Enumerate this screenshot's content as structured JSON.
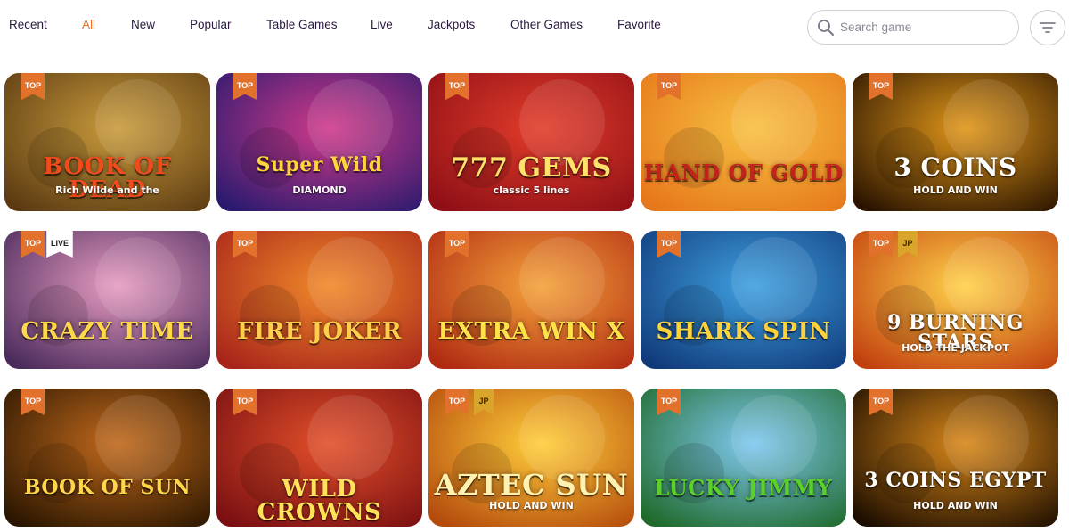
{
  "nav": {
    "tabs": [
      {
        "label": "Recent"
      },
      {
        "label": "All"
      },
      {
        "label": "New"
      },
      {
        "label": "Popular"
      },
      {
        "label": "Table Games"
      },
      {
        "label": "Live"
      },
      {
        "label": "Jackpots"
      },
      {
        "label": "Other Games"
      },
      {
        "label": "Favorite"
      }
    ],
    "active_tab": "All",
    "accent_color": "#e8722a"
  },
  "search": {
    "placeholder": "Search game",
    "value": "",
    "icon": "search-icon"
  },
  "filter": {
    "icon": "filter-lines-icon"
  },
  "games": [
    {
      "title": "BOOK OF DEAD",
      "subtitle": "Rich Wilde and the",
      "badges": [
        "TOP"
      ],
      "colors": [
        "#5b3a12",
        "#c99b3c"
      ],
      "title_color": "#f04a1d"
    },
    {
      "title": "Super Wild",
      "subtitle": "DIAMOND",
      "badges": [
        "TOP"
      ],
      "colors": [
        "#2a1a6e",
        "#d03a8a"
      ],
      "title_color": "#ffd53a"
    },
    {
      "title": "777 GEMS",
      "subtitle": "classic 5 lines",
      "badges": [
        "TOP"
      ],
      "colors": [
        "#8e0f16",
        "#e23c2a"
      ],
      "title_color": "#ffe06a"
    },
    {
      "title": "HAND OF GOLD",
      "subtitle": "",
      "badges": [
        "TOP"
      ],
      "colors": [
        "#e6771a",
        "#f7c042"
      ],
      "title_color": "#c2231a"
    },
    {
      "title": "3 COINS",
      "subtitle": "HOLD AND WIN",
      "badges": [
        "TOP"
      ],
      "colors": [
        "#2a1400",
        "#e0961a"
      ],
      "title_color": "#ffffff"
    },
    {
      "title": "CRAZY TIME",
      "subtitle": "",
      "badges": [
        "TOP",
        "LIVE"
      ],
      "colors": [
        "#4a2b5c",
        "#e69bc0"
      ],
      "title_color": "#ffd84a"
    },
    {
      "title": "FIRE JOKER",
      "subtitle": "",
      "badges": [
        "TOP"
      ],
      "colors": [
        "#a8241a",
        "#f08a2a"
      ],
      "title_color": "#ffce4a"
    },
    {
      "title": "EXTRA WIN X",
      "subtitle": "",
      "badges": [
        "TOP"
      ],
      "colors": [
        "#b02a12",
        "#f4a23a"
      ],
      "title_color": "#ffe14a"
    },
    {
      "title": "SHARK SPIN",
      "subtitle": "",
      "badges": [
        "TOP"
      ],
      "colors": [
        "#103a7a",
        "#3fa0e0"
      ],
      "title_color": "#ffd23a"
    },
    {
      "title": "9 BURNING STARS",
      "subtitle": "HOLD THE JACKPOT",
      "badges": [
        "TOP",
        "JP"
      ],
      "colors": [
        "#c2400e",
        "#ffd24a"
      ],
      "title_color": "#ffffff"
    },
    {
      "title": "BOOK OF SUN",
      "subtitle": "",
      "badges": [
        "TOP"
      ],
      "colors": [
        "#2a1600",
        "#c1691c"
      ],
      "title_color": "#ffd54a"
    },
    {
      "title": "WILD CROWNS",
      "subtitle": "",
      "badges": [
        "TOP"
      ],
      "colors": [
        "#7a0f12",
        "#e3502a"
      ],
      "title_color": "#ffe25a"
    },
    {
      "title": "AZTEC SUN",
      "subtitle": "HOLD AND WIN",
      "badges": [
        "TOP",
        "JP"
      ],
      "colors": [
        "#b44a0c",
        "#ffce3a"
      ],
      "title_color": "#fff2b0"
    },
    {
      "title": "LUCKY JIMMY",
      "subtitle": "",
      "badges": [
        "TOP"
      ],
      "colors": [
        "#1f6a2a",
        "#7fc8f0"
      ],
      "title_color": "#5ad02a"
    },
    {
      "title": "3 COINS EGYPT",
      "subtitle": "HOLD AND WIN",
      "badges": [
        "TOP"
      ],
      "colors": [
        "#1c0d00",
        "#d9881a"
      ],
      "title_color": "#ffffff"
    }
  ]
}
